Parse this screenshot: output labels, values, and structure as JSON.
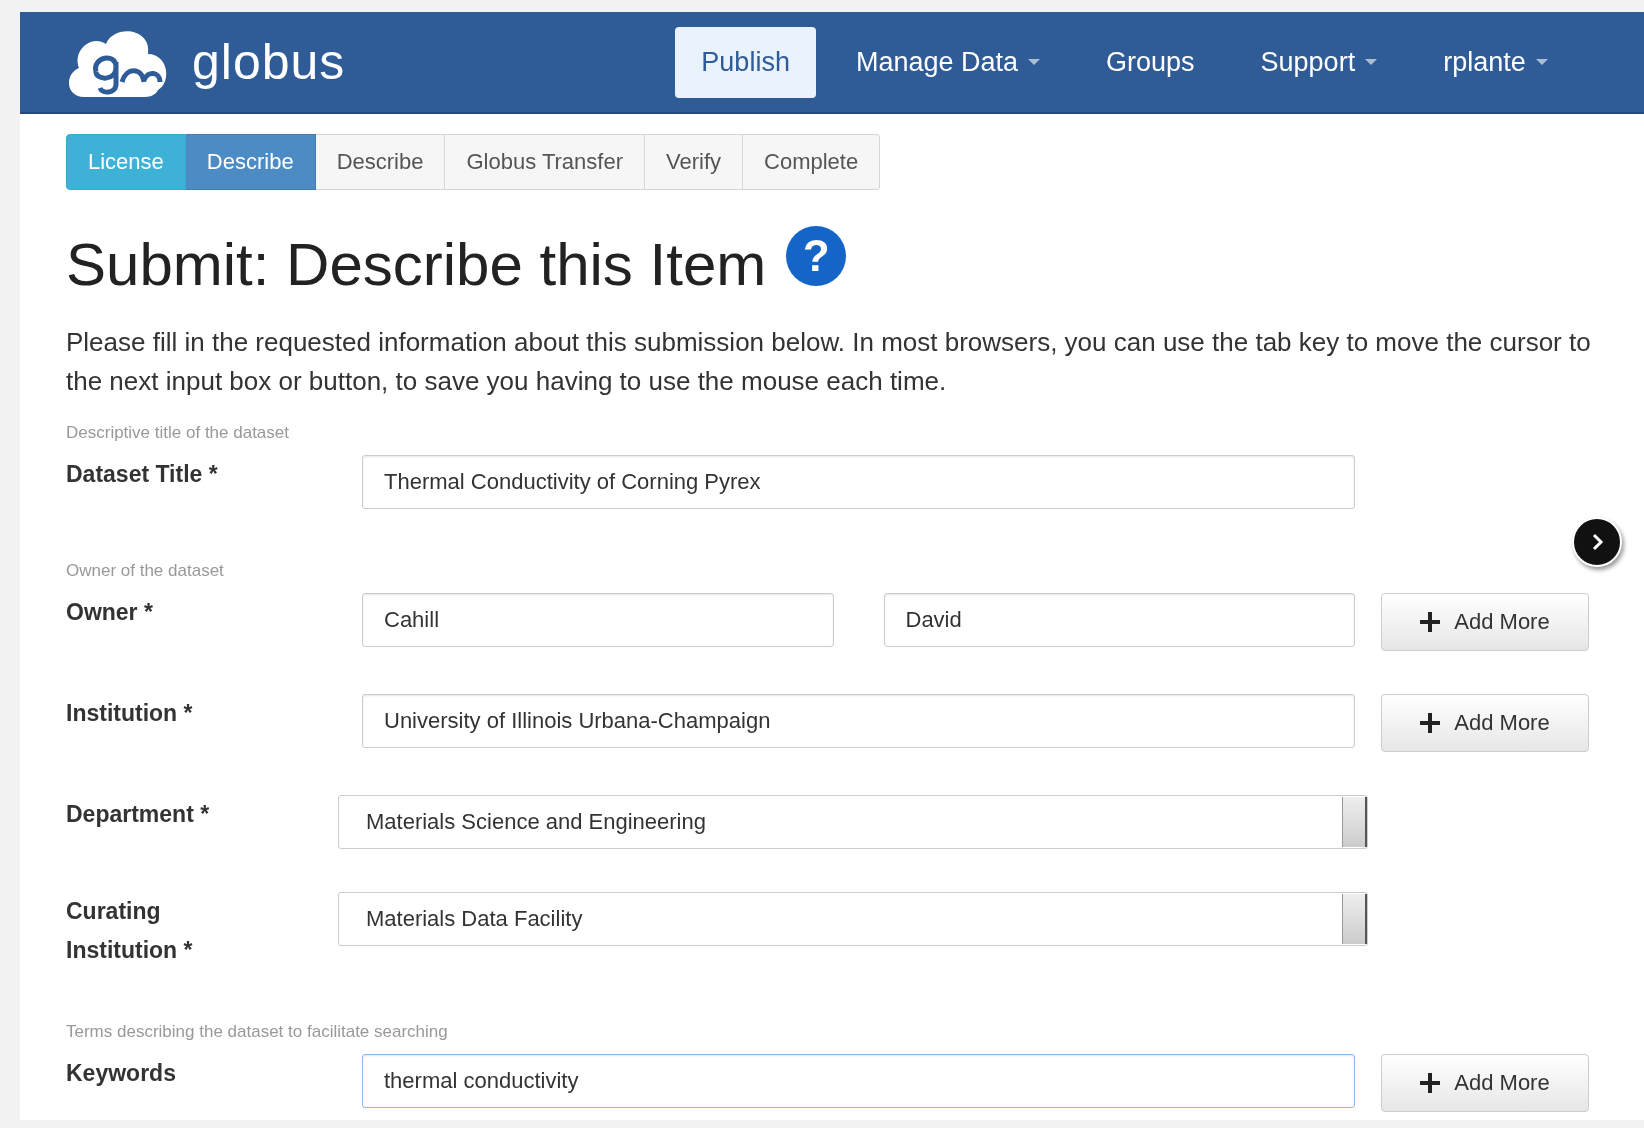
{
  "navbar": {
    "brand": "globus",
    "items": [
      {
        "label": "Publish",
        "selected": true,
        "dropdown": false
      },
      {
        "label": "Manage Data",
        "selected": false,
        "dropdown": true
      },
      {
        "label": "Groups",
        "selected": false,
        "dropdown": false
      },
      {
        "label": "Support",
        "selected": false,
        "dropdown": true
      },
      {
        "label": "rplante",
        "selected": false,
        "dropdown": true
      }
    ]
  },
  "steps": [
    {
      "label": "License",
      "completed": true,
      "selected": false
    },
    {
      "label": "Describe",
      "completed": false,
      "selected": true
    },
    {
      "label": "Describe",
      "completed": false,
      "selected": false
    },
    {
      "label": "Globus Transfer",
      "completed": false,
      "selected": false
    },
    {
      "label": "Verify",
      "completed": false,
      "selected": false
    },
    {
      "label": "Complete",
      "completed": false,
      "selected": false
    }
  ],
  "title": "Submit: Describe this Item",
  "help_icon": "?",
  "intro": "Please fill in the requested information about this submission below. In most browsers, you can use the tab key to move the cursor to the next input box or button, to save you having to use the mouse each time.",
  "form": [
    {
      "hint": "Descriptive title of the dataset",
      "label": "Dataset Title *",
      "fields": [
        {
          "kind": "input",
          "value": "Thermal Conductivity of Corning Pyrex",
          "focused": false
        }
      ]
    },
    {
      "hint": "Owner of the dataset",
      "label": "Owner *",
      "fields": [
        {
          "kind": "input",
          "value": "Cahill",
          "focused": false
        },
        {
          "kind": "input",
          "value": "David",
          "focused": false
        }
      ],
      "add_more": "Add More"
    },
    {
      "label": "Institution *",
      "fields": [
        {
          "kind": "input",
          "value": "University of Illinois Urbana-Champaign",
          "focused": false
        }
      ],
      "add_more": "Add More"
    },
    {
      "label": "Department *",
      "fields": [
        {
          "kind": "select",
          "value": "Materials Science and Engineering",
          "focused": false
        }
      ]
    },
    {
      "label": "Curating Institution *",
      "fields": [
        {
          "kind": "select",
          "value": "Materials Data Facility",
          "focused": false
        }
      ]
    },
    {
      "hint": "Terms describing the dataset to facilitate searching",
      "label": "Keywords",
      "fields": [
        {
          "kind": "input",
          "value": "thermal conductivity",
          "focused": true
        }
      ],
      "add_more": "Add More"
    }
  ]
}
